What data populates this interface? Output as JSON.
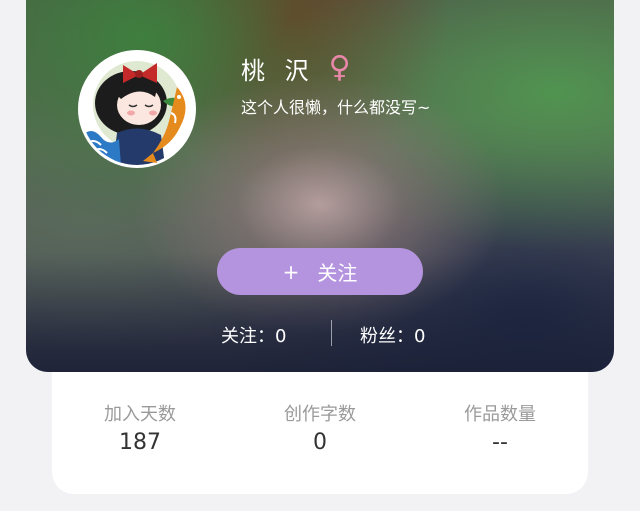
{
  "profile": {
    "name": "桃 沢",
    "gender_symbol": "♀",
    "bio": "这个人很懒，什么都没写~",
    "avatar_icon": "avatar-girl-icon"
  },
  "actions": {
    "follow_plus": "+",
    "follow_label": "关注"
  },
  "social": {
    "following": "关注：0",
    "fans": "粉丝：0"
  },
  "stats": [
    {
      "label": "加入天数",
      "value": "187"
    },
    {
      "label": "创作字数",
      "value": "0"
    },
    {
      "label": "作品数量",
      "value": "--"
    }
  ],
  "colors": {
    "follow_button": "#b594df",
    "gender_female": "#e887a8"
  }
}
